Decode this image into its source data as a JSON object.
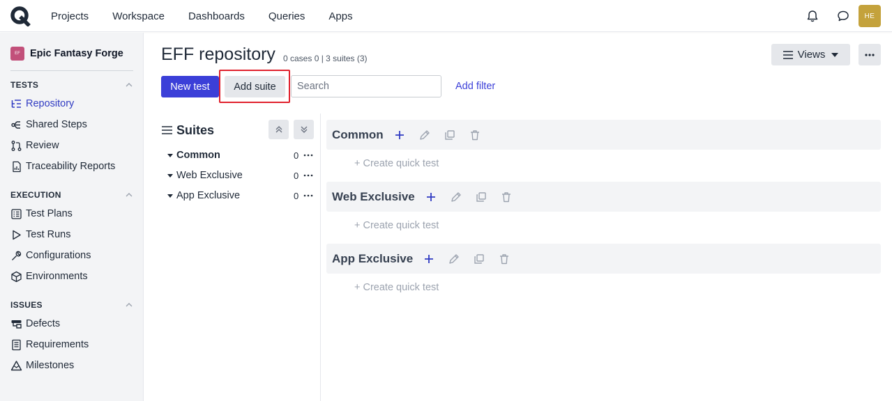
{
  "nav": {
    "items": [
      "Projects",
      "Workspace",
      "Dashboards",
      "Queries",
      "Apps"
    ],
    "avatar_initials": "HE"
  },
  "sidebar": {
    "project_badge": "EF",
    "project_name": "Epic Fantasy Forge",
    "sections": [
      {
        "title": "TESTS",
        "items": [
          {
            "label": "Repository",
            "icon": "repository-icon",
            "active": true
          },
          {
            "label": "Shared Steps",
            "icon": "shared-steps-icon"
          },
          {
            "label": "Review",
            "icon": "review-icon"
          },
          {
            "label": "Traceability Reports",
            "icon": "report-icon"
          }
        ]
      },
      {
        "title": "EXECUTION",
        "items": [
          {
            "label": "Test Plans",
            "icon": "test-plans-icon"
          },
          {
            "label": "Test Runs",
            "icon": "play-icon"
          },
          {
            "label": "Configurations",
            "icon": "wrench-icon"
          },
          {
            "label": "Environments",
            "icon": "cube-icon"
          }
        ]
      },
      {
        "title": "ISSUES",
        "items": [
          {
            "label": "Defects",
            "icon": "defects-icon"
          },
          {
            "label": "Requirements",
            "icon": "requirements-icon"
          },
          {
            "label": "Milestones",
            "icon": "milestone-icon"
          }
        ]
      }
    ]
  },
  "header": {
    "title": "EFF repository",
    "meta": "0 cases 0 | 3 suites (3)",
    "views_label": "Views"
  },
  "toolbar": {
    "new_test": "New test",
    "add_suite": "Add suite",
    "search_placeholder": "Search",
    "add_filter": "Add filter"
  },
  "suites_panel": {
    "title": "Suites",
    "items": [
      {
        "name": "Common",
        "count": "0",
        "bold": true
      },
      {
        "name": "Web Exclusive",
        "count": "0",
        "bold": false
      },
      {
        "name": "App Exclusive",
        "count": "0",
        "bold": false
      }
    ]
  },
  "suite_cards": [
    {
      "name": "Common",
      "quick_label": "+ Create quick test"
    },
    {
      "name": "Web Exclusive",
      "quick_label": "+ Create quick test"
    },
    {
      "name": "App Exclusive",
      "quick_label": "+ Create quick test"
    }
  ],
  "colors": {
    "primary": "#3b3fd8",
    "active_link": "#2f3ac2",
    "highlight": "#e0202c",
    "avatar": "#c4a23c",
    "project_badge": "#c2507a"
  }
}
